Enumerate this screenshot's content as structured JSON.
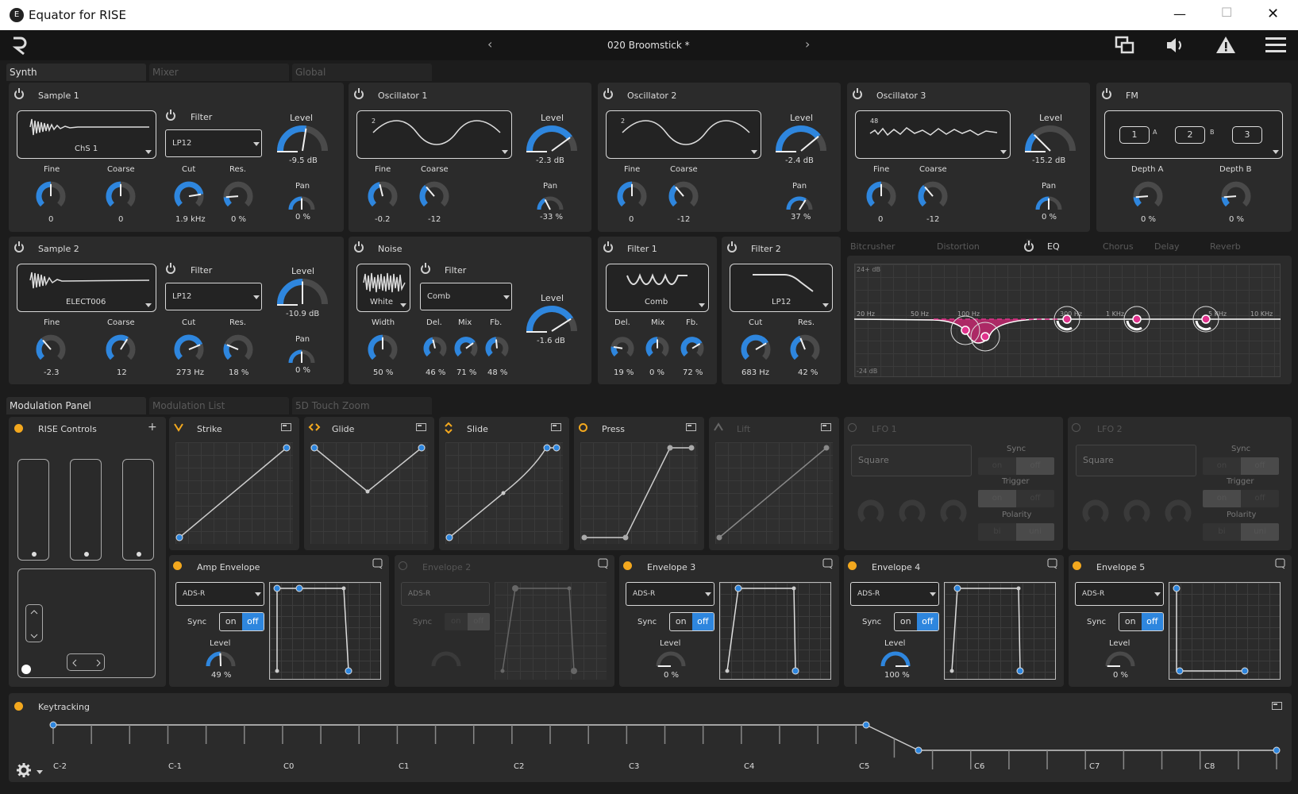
{
  "window": {
    "title": "Equator for RISE",
    "app_letter": "E",
    "min": "—",
    "max": "☐",
    "close": "✕"
  },
  "header": {
    "preset": "020 Broomstick *",
    "prev": "‹",
    "next": "›"
  },
  "tabs_top": [
    {
      "label": "Synth"
    },
    {
      "label": "Mixer"
    },
    {
      "label": "Global"
    }
  ],
  "sample1": {
    "title": "Sample 1",
    "wave_name": "ChS 1",
    "filter_title": "Filter",
    "filter_type": "LP12",
    "level_label": "Level",
    "level_value": "-9.5 dB",
    "pan_label": "Pan",
    "pan_value": "0 %",
    "fine_label": "Fine",
    "fine_value": "0",
    "coarse_label": "Coarse",
    "coarse_value": "0",
    "cut_label": "Cut",
    "cut_value": "1.9 kHz",
    "res_label": "Res.",
    "res_value": "0 %"
  },
  "osc1": {
    "title": "Oscillator 1",
    "num": "2",
    "level_label": "Level",
    "level_value": "-2.3 dB",
    "fine_label": "Fine",
    "fine_value": "-0.2",
    "coarse_label": "Coarse",
    "coarse_value": "-12",
    "pan_label": "Pan",
    "pan_value": "-33 %"
  },
  "osc2": {
    "title": "Oscillator 2",
    "num": "2",
    "level_label": "Level",
    "level_value": "-2.4 dB",
    "fine_label": "Fine",
    "fine_value": "0",
    "coarse_label": "Coarse",
    "coarse_value": "-12",
    "pan_label": "Pan",
    "pan_value": "37 %"
  },
  "osc3": {
    "title": "Oscillator 3",
    "num": "48",
    "level_label": "Level",
    "level_value": "-15.2 dB",
    "fine_label": "Fine",
    "fine_value": "0",
    "coarse_label": "Coarse",
    "coarse_value": "-12",
    "pan_label": "Pan",
    "pan_value": "0 %"
  },
  "fm": {
    "title": "FM",
    "n1": "1",
    "n2": "2",
    "n3": "3",
    "a": "A",
    "b": "B",
    "depth_a_label": "Depth A",
    "depth_a_value": "0 %",
    "depth_b_label": "Depth B",
    "depth_b_value": "0 %"
  },
  "sample2": {
    "title": "Sample 2",
    "wave_name": "ELECT006",
    "filter_title": "Filter",
    "filter_type": "LP12",
    "level_label": "Level",
    "level_value": "-10.9 dB",
    "pan_label": "Pan",
    "pan_value": "0 %",
    "fine_label": "Fine",
    "fine_value": "-2.3",
    "coarse_label": "Coarse",
    "coarse_value": "12",
    "cut_label": "Cut",
    "cut_value": "273 Hz",
    "res_label": "Res.",
    "res_value": "18 %"
  },
  "noise": {
    "title": "Noise",
    "type": "White",
    "filter_title": "Filter",
    "filter_type": "Comb",
    "width_label": "Width",
    "width_value": "50 %",
    "del_label": "Del.",
    "del_value": "46 %",
    "mix_label": "Mix",
    "mix_value": "71 %",
    "fb_label": "Fb.",
    "fb_value": "48 %",
    "level_label": "Level",
    "level_value": "-1.6 dB"
  },
  "filter1": {
    "title": "Filter 1",
    "type": "Comb",
    "del_label": "Del.",
    "del_value": "19 %",
    "mix_label": "Mix",
    "mix_value": "0 %",
    "fb_label": "Fb.",
    "fb_value": "72 %"
  },
  "filter2": {
    "title": "Filter 2",
    "type": "LP12",
    "cut_label": "Cut",
    "cut_value": "683 Hz",
    "res_label": "Res.",
    "res_value": "42 %"
  },
  "fx_tabs": [
    {
      "label": "Bitcrusher"
    },
    {
      "label": "Distortion"
    },
    {
      "label": "EQ"
    },
    {
      "label": "Chorus"
    },
    {
      "label": "Delay"
    },
    {
      "label": "Reverb"
    }
  ],
  "eq": {
    "top_db": "24+ dB",
    "bot_db": "-24 dB",
    "freqs": [
      "20 Hz",
      "50 Hz",
      "100 Hz",
      "300 Hz",
      "1 KHz",
      "5 KHz",
      "10 KHz"
    ]
  },
  "mod_tabs": [
    {
      "label": "Modulation Panel"
    },
    {
      "label": "Modulation List"
    },
    {
      "label": "5D Touch Zoom"
    }
  ],
  "rise": {
    "title": "RISE Controls",
    "plus": "+"
  },
  "curves": {
    "strike": "Strike",
    "glide": "Glide",
    "slide": "Slide",
    "press": "Press",
    "lift": "Lift"
  },
  "lfo1": {
    "title": "LFO 1",
    "shape": "Square",
    "sync": "Sync",
    "trigger": "Trigger",
    "polarity": "Polarity",
    "on": "on",
    "off": "off",
    "bi": "bi",
    "uni": "uni"
  },
  "lfo2": {
    "title": "LFO 2",
    "shape": "Square",
    "sync": "Sync",
    "trigger": "Trigger",
    "polarity": "Polarity",
    "on": "on",
    "off": "off",
    "bi": "bi",
    "uni": "uni"
  },
  "env": [
    {
      "title": "Amp Envelope",
      "mode": "ADS-R",
      "sync": "Sync",
      "on": "on",
      "off": "off",
      "level_label": "Level",
      "level_value": "49 %"
    },
    {
      "title": "Envelope 2",
      "mode": "ADS-R",
      "sync": "Sync",
      "on": "on",
      "off": "off",
      "level_label": "",
      "level_value": ""
    },
    {
      "title": "Envelope 3",
      "mode": "ADS-R",
      "sync": "Sync",
      "on": "on",
      "off": "off",
      "level_label": "Level",
      "level_value": "0 %"
    },
    {
      "title": "Envelope 4",
      "mode": "ADS-R",
      "sync": "Sync",
      "on": "on",
      "off": "off",
      "level_label": "Level",
      "level_value": "100 %"
    },
    {
      "title": "Envelope 5",
      "mode": "ADS-R",
      "sync": "Sync",
      "on": "on",
      "off": "off",
      "level_label": "Level",
      "level_value": "0 %"
    }
  ],
  "keytracking": {
    "title": "Keytracking",
    "notes": [
      "C-2",
      "C-1",
      "C0",
      "C1",
      "C2",
      "C3",
      "C4",
      "C5",
      "C6",
      "C7",
      "C8"
    ]
  },
  "accent": "#2e86de",
  "pink": "#e0338c",
  "orange": "#f3a81e"
}
